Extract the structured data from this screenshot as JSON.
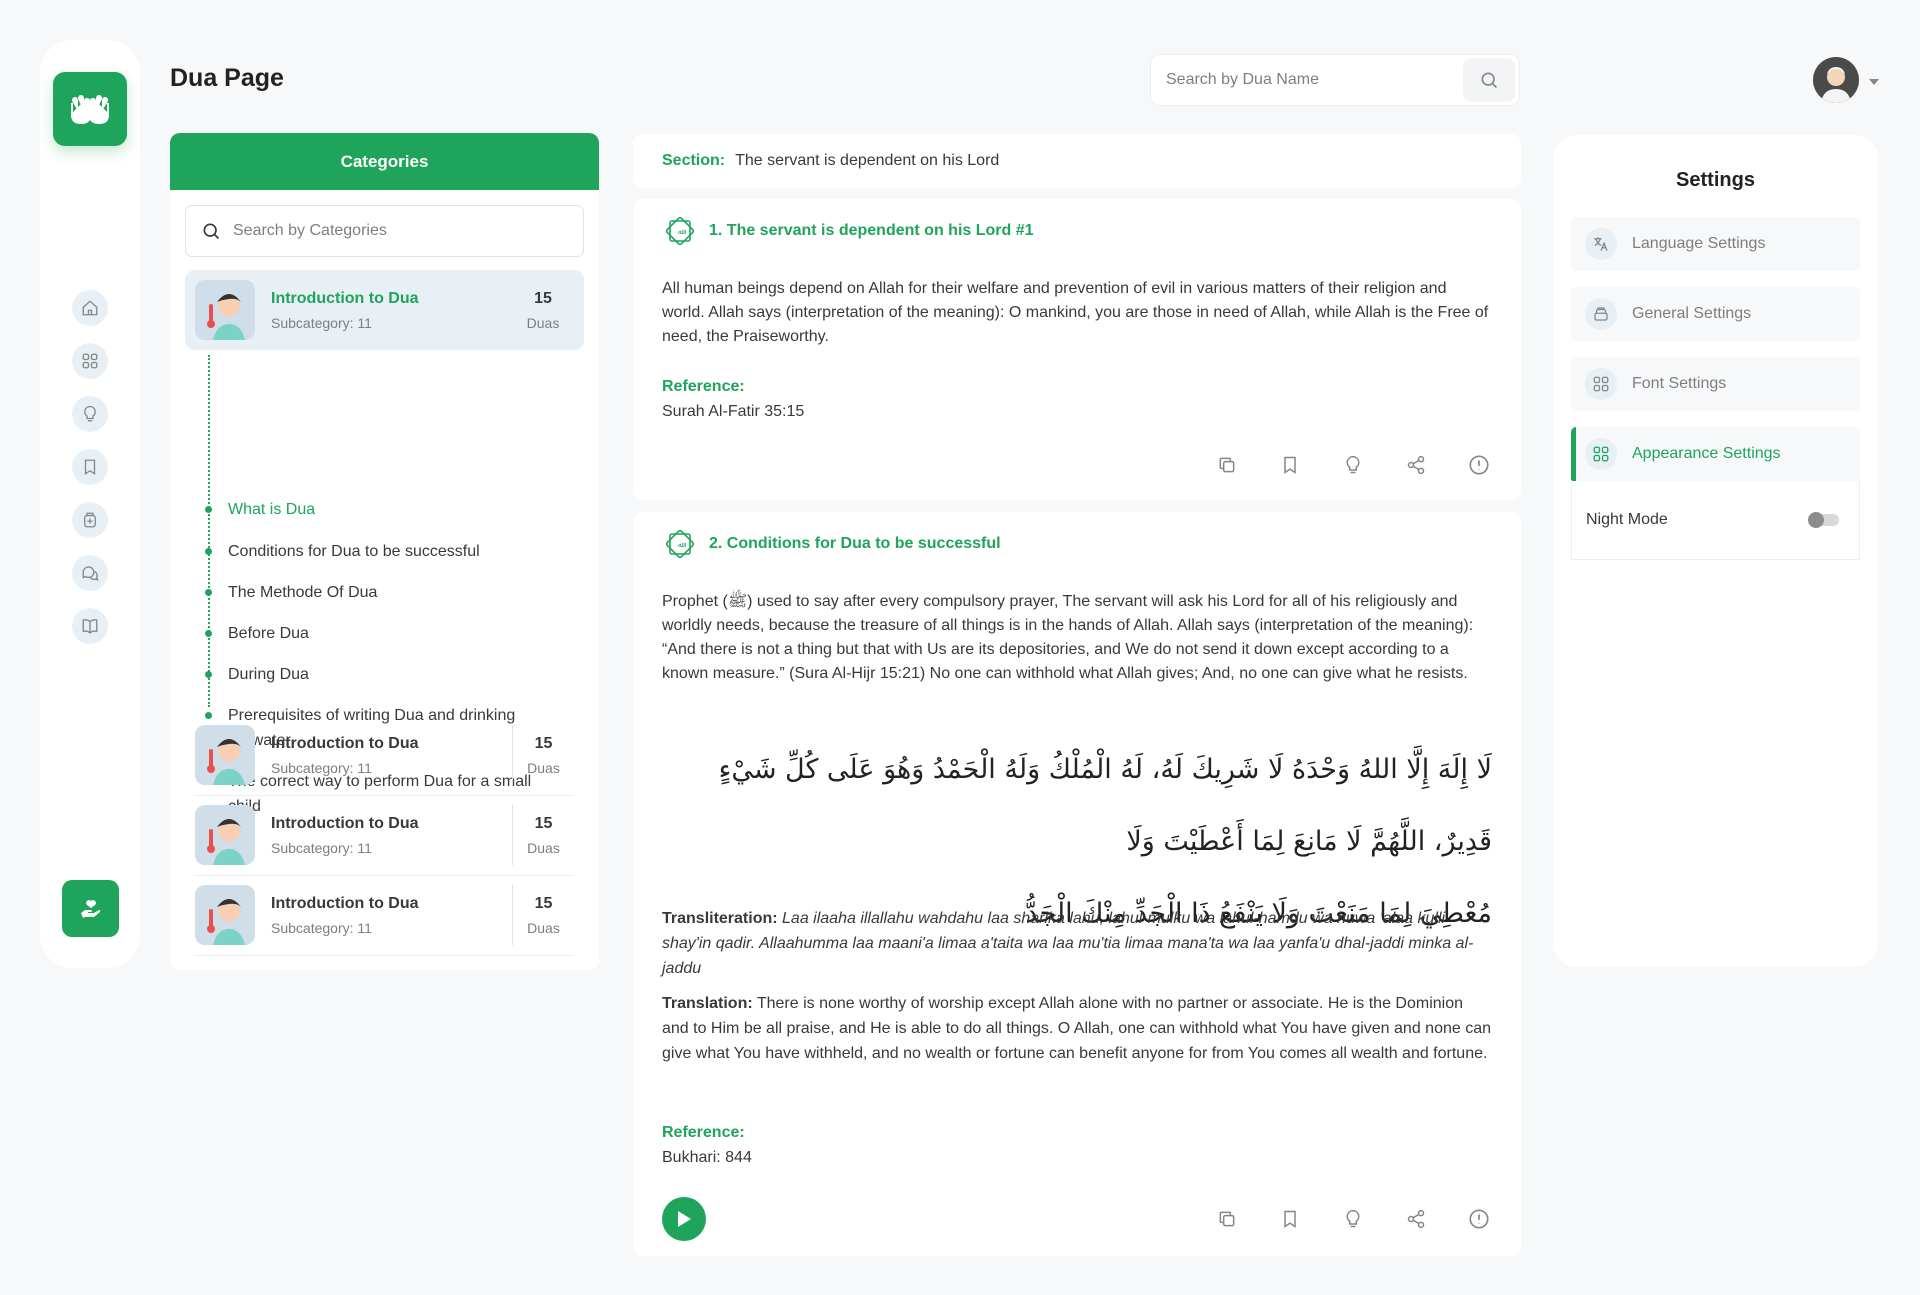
{
  "page": {
    "title": "Dua Page"
  },
  "colors": {
    "accent": "#1fa45b",
    "background": "#f7f8fa"
  },
  "header": {
    "search_placeholder": "Search by Dua Name",
    "avatar_icon": "user-avatar"
  },
  "rail": {
    "logo_icon": "praying-hands-icon",
    "items": [
      "home-icon",
      "grid-icon",
      "lightbulb-icon",
      "bookmark-icon",
      "ruqyah-icon",
      "chat-icon",
      "book-icon"
    ],
    "cta_icon": "donate-hand-icon"
  },
  "categories": {
    "header": "Categories",
    "search_placeholder": "Search by Categories",
    "active": {
      "name": "Introduction to Dua",
      "sub": "Subcategory: 11",
      "count": "15",
      "unit": "Duas"
    },
    "subcategories": [
      "What is Dua",
      "Conditions for Dua to be successful",
      "The Methode Of Dua",
      "Before Dua",
      "During Dua",
      "Prerequisites of writing Dua and drinking it’s water",
      "The correct way to perform Dua for a small child"
    ],
    "items": [
      {
        "name": "Introduction to Dua",
        "sub": "Subcategory: 11",
        "count": "15",
        "unit": "Duas"
      },
      {
        "name": "Introduction to Dua",
        "sub": "Subcategory: 11",
        "count": "15",
        "unit": "Duas"
      },
      {
        "name": "Introduction to Dua",
        "sub": "Subcategory: 11",
        "count": "15",
        "unit": "Duas"
      }
    ]
  },
  "section": {
    "label": "Section:",
    "value": "The servant is dependent on his Lord"
  },
  "duas": [
    {
      "title": "1. The servant is dependent on his Lord #1",
      "body": "All human beings depend on Allah for their welfare and prevention of evil in various matters of their religion and world. Allah says (interpretation of the meaning): O mankind, you are those in need of Allah, while Allah is the Free of need, the Praiseworthy.",
      "reference_label": "Reference:",
      "reference": "Surah Al-Fatir 35:15"
    },
    {
      "title": "2. Conditions for Dua to be successful",
      "body": "Prophet (ﷺ) used to say after every compulsory prayer, The servant will ask his Lord for all of his religiously and worldly needs, because the treasure of all things is in the hands of Allah. Allah says (interpretation of the meaning): “And there is not a thing but that with Us are its depositories, and We do not send it down except according to a known measure.” (Sura Al-Hijr 15:21) No one can withhold what Allah gives; And, no one can give what he resists.",
      "arabic_line1": "لَا إِلَهَ إِلَّا اللهُ وَحْدَهُ لَا شَرِيكَ لَهُ، لَهُ الْمُلْكُ وَلَهُ الْحَمْدُ وَهُوَ عَلَى كُلِّ شَيْءٍ قَدِيرٌ، اللَّهُمَّ لَا مَانِعَ لِمَا أَعْطَيْتَ وَلَا",
      "arabic_line2": "مُعْطِيَ لِمَا مَنَعْتَ وَلَا يَنْفَعُ ذَا الْجَدِّ مِنْكَ الْجَدُّ",
      "transliteration_label": "Transliteration:",
      "transliteration": "Laa ilaaha illallahu wahdahu laa sharika lahu, lahul-mulku wa lahul-hamdu wa huwa 'alaa kulli shay'in qadir. Allaahumma laa maani'a limaa a'taita wa laa mu'tia limaa mana'ta wa laa yanfa'u dhal-jaddi minka al-jaddu",
      "translation_label": "Translation:",
      "translation": "There is none worthy of worship except Allah alone with no partner or associate. He is the Dominion and to Him be all praise, and He is able to do all things. O Allah, one can withhold what You have given and none can give what You have withheld, and no wealth or fortune can benefit anyone for from You comes all wealth and fortune.",
      "reference_label": "Reference:",
      "reference": "Bukhari: 844"
    }
  ],
  "action_icons": [
    "copy-icon",
    "bookmark-icon",
    "lightbulb-icon",
    "share-icon",
    "report-icon"
  ],
  "settings": {
    "title": "Settings",
    "items": [
      "Language Settings",
      "General Settings",
      "Font Settings",
      "Appearance Settings"
    ],
    "active": "Appearance Settings",
    "night_mode_label": "Night Mode",
    "night_mode": false
  }
}
